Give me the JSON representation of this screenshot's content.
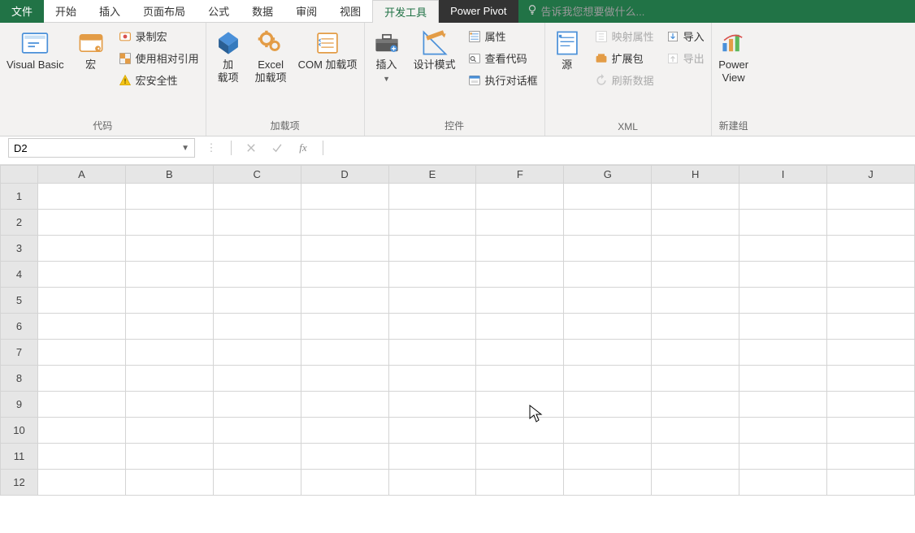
{
  "menu": {
    "file": "文件",
    "home": "开始",
    "insert": "插入",
    "page_layout": "页面布局",
    "formulas": "公式",
    "data": "数据",
    "review": "审阅",
    "view": "视图",
    "developer": "开发工具",
    "power_pivot": "Power Pivot",
    "tell_me": "告诉我您想要做什么..."
  },
  "ribbon": {
    "code": {
      "vb": "Visual Basic",
      "macros": "宏",
      "record_macro": "录制宏",
      "relative_ref": "使用相对引用",
      "macro_security": "宏安全性",
      "label": "代码"
    },
    "addins": {
      "addins_line1": "加",
      "addins_line2": "载项",
      "excel_addins_line1": "Excel",
      "excel_addins_line2": "加载项",
      "com_addins": "COM 加载项",
      "label": "加载项"
    },
    "controls": {
      "insert": "插入",
      "design_mode": "设计模式",
      "properties": "属性",
      "view_code": "查看代码",
      "run_dialog": "执行对话框",
      "label": "控件"
    },
    "xml": {
      "source": "源",
      "map_props": "映射属性",
      "expansion": "扩展包",
      "refresh": "刷新数据",
      "import": "导入",
      "export": "导出",
      "label": "XML"
    },
    "new_group": {
      "power_line1": "Power",
      "power_line2": "View",
      "label": "新建组"
    }
  },
  "formula_bar": {
    "name_box": "D2",
    "fx": "fx",
    "formula_value": ""
  },
  "grid": {
    "columns": [
      "A",
      "B",
      "C",
      "D",
      "E",
      "F",
      "G",
      "H",
      "I",
      "J"
    ],
    "rows": [
      "1",
      "2",
      "3",
      "4",
      "5",
      "6",
      "7",
      "8",
      "9",
      "10",
      "11",
      "12"
    ]
  },
  "colors": {
    "accent": "#217346"
  }
}
